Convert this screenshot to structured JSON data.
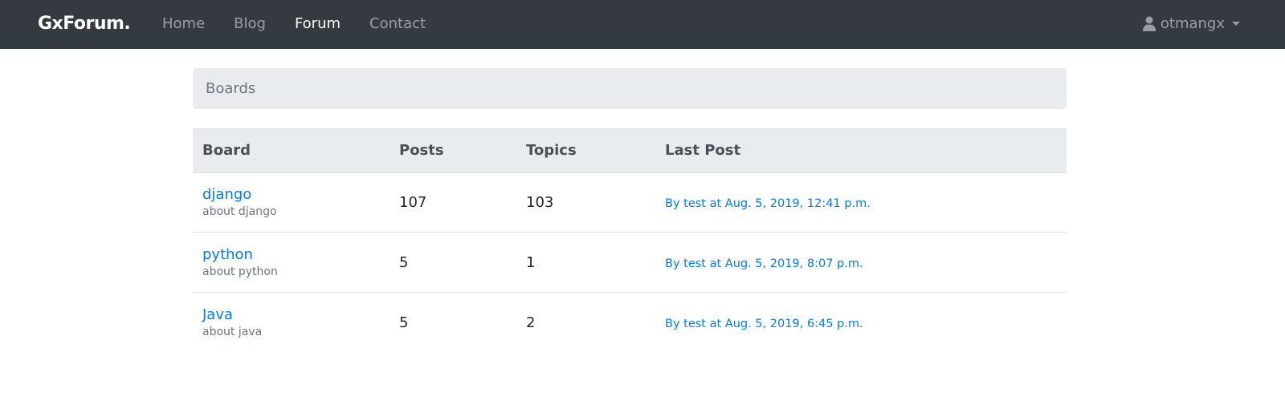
{
  "navbar": {
    "brand": "GxForum.",
    "links": [
      {
        "label": "Home",
        "active": false
      },
      {
        "label": "Blog",
        "active": false
      },
      {
        "label": "Forum",
        "active": true
      },
      {
        "label": "Contact",
        "active": false
      }
    ],
    "user": {
      "name": "otmangx",
      "icon": "user-icon"
    }
  },
  "breadcrumb": {
    "label": "Boards"
  },
  "table": {
    "headers": {
      "board": "Board",
      "posts": "Posts",
      "topics": "Topics",
      "last_post": "Last Post"
    },
    "rows": [
      {
        "name": "django",
        "description": "about django",
        "posts": "107",
        "topics": "103",
        "last_post": "By test at Aug. 5, 2019, 12:41 p.m."
      },
      {
        "name": "python",
        "description": "about python",
        "posts": "5",
        "topics": "1",
        "last_post": "By test at Aug. 5, 2019, 8:07 p.m."
      },
      {
        "name": "Java",
        "description": "about java",
        "posts": "5",
        "topics": "2",
        "last_post": "By test at Aug. 5, 2019, 6:45 p.m."
      }
    ]
  },
  "colors": {
    "navbar_bg": "#343a40",
    "link": "#007bff",
    "muted": "#6c757d",
    "header_bg": "#e9ecef"
  }
}
